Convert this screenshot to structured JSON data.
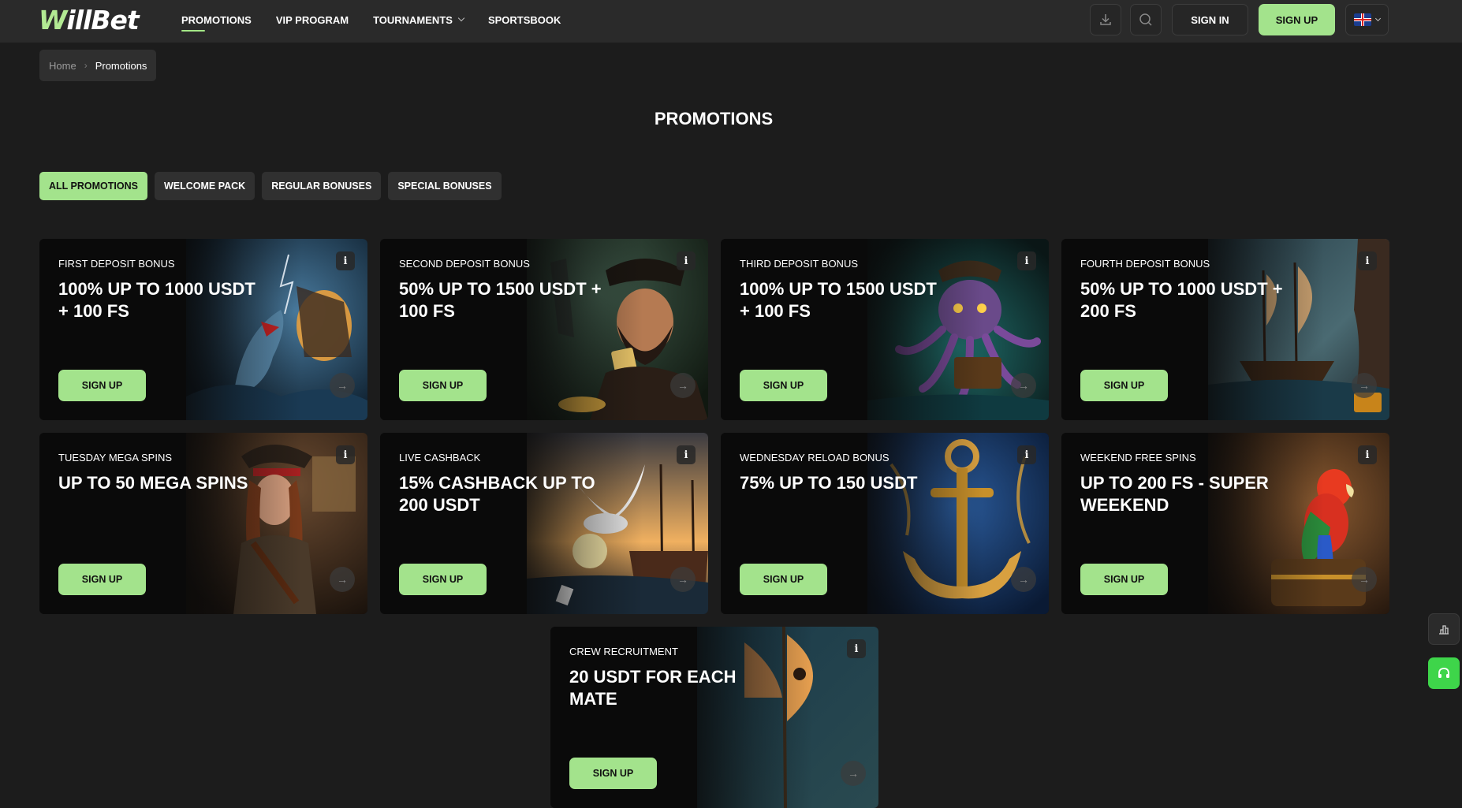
{
  "header": {
    "logo": "WillBet",
    "nav": [
      "PROMOTIONS",
      "VIP PROGRAM",
      "TOURNAMENTS",
      "SPORTSBOOK"
    ],
    "signin_label": "SIGN IN",
    "signup_label": "SIGN UP"
  },
  "breadcrumb": {
    "home": "Home",
    "current": "Promotions"
  },
  "page_title": "PROMOTIONS",
  "tabs": [
    "ALL PROMOTIONS",
    "WELCOME PACK",
    "REGULAR BONUSES",
    "SPECIAL BONUSES"
  ],
  "cards": [
    {
      "sub": "FIRST DEPOSIT BONUS",
      "head": "100% UP TO 1000 USDT + 100 FS",
      "cta": "SIGN UP",
      "art": "shark-ship"
    },
    {
      "sub": "SECOND DEPOSIT BONUS",
      "head": "50% UP TO 1500 USDT + 100 FS",
      "cta": "SIGN UP",
      "art": "pirate-captain"
    },
    {
      "sub": "THIRD DEPOSIT BONUS",
      "head": "100% UP TO 1500 USDT + 100 FS",
      "cta": "SIGN UP",
      "art": "octopus"
    },
    {
      "sub": "FOURTH DEPOSIT BONUS",
      "head": "50% UP TO 1000 USDT + 200 FS",
      "cta": "SIGN UP",
      "art": "pirate-ship-cave"
    },
    {
      "sub": "TUESDAY MEGA SPINS",
      "head": "UP TO 50 MEGA SPINS",
      "cta": "SIGN UP",
      "art": "pirate-woman"
    },
    {
      "sub": "LIVE CASHBACK",
      "head": "15% CASHBACK UP TO 200 USDT",
      "cta": "SIGN UP",
      "art": "seagull"
    },
    {
      "sub": "WEDNESDAY RELOAD BONUS",
      "head": "75% UP TO 150 USDT",
      "cta": "SIGN UP",
      "art": "anchor"
    },
    {
      "sub": "WEEKEND FREE SPINS",
      "head": "UP TO 200 FS - SUPER WEEKEND",
      "cta": "SIGN UP",
      "art": "parrot"
    },
    {
      "sub": "CREW RECRUITMENT",
      "head": "20 USDT FOR EACH MATE",
      "cta": "SIGN UP",
      "art": "ship-sails"
    }
  ],
  "icons": {
    "download": "download-icon",
    "search": "search-icon",
    "flag": "uk-flag-icon",
    "info": "info-icon",
    "arrow": "arrow-right-icon",
    "stats": "leaderboard-icon",
    "support": "headset-icon"
  },
  "colors": {
    "accent": "#a3e38c",
    "background": "#1c1c1c",
    "header": "#2a2a2a",
    "support": "#3ed54a"
  }
}
